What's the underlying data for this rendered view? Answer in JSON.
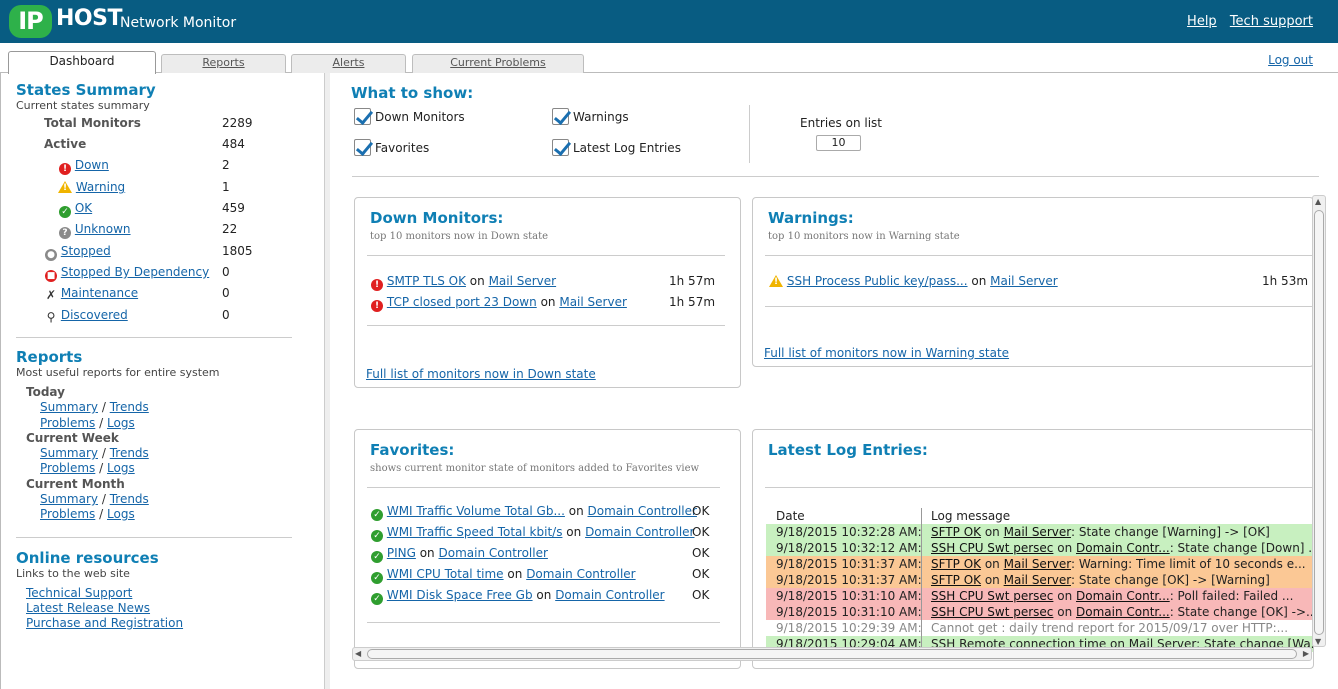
{
  "header": {
    "logo_ip": "IP",
    "logo_host": "HOST",
    "logo_subtitle": "Network Monitor",
    "links": [
      "Help",
      "Tech support"
    ],
    "colors": {
      "bar": "#085c82",
      "logo_green": "#2eb14a"
    }
  },
  "tabs": [
    "Dashboard",
    "Reports",
    "Alerts",
    "Current Problems"
  ],
  "logout": "Log out",
  "sidebar": {
    "states": {
      "title": "States Summary",
      "subtitle": "Current states summary",
      "total_label": "Total Monitors",
      "total_value": "2289",
      "active_label": "Active",
      "active_value": "484",
      "down_label": "Down",
      "down_value": "2",
      "warning_label": "Warning",
      "warning_value": "1",
      "ok_label": "OK",
      "ok_value": "459",
      "unknown_label": "Unknown",
      "unknown_value": "22",
      "stopped_label": "Stopped",
      "stopped_value": "1805",
      "stopped_dep_label": "Stopped By Dependency",
      "stopped_dep_value": "0",
      "maintenance_label": "Maintenance",
      "maintenance_value": "0",
      "discovered_label": "Discovered",
      "discovered_value": "0"
    },
    "reports": {
      "title": "Reports",
      "subtitle": "Most useful reports for entire system",
      "groups": [
        {
          "label": "Today"
        },
        {
          "label": "Current Week"
        },
        {
          "label": "Current Month"
        }
      ],
      "summary": "Summary",
      "trends": "Trends",
      "problems": "Problems",
      "logs": "Logs",
      "slash": "/"
    },
    "resources": {
      "title": "Online resources",
      "subtitle": "Links to the web site",
      "links": [
        "Technical Support",
        "Latest Release News",
        "Purchase and Registration"
      ]
    }
  },
  "show": {
    "title": "What to show:",
    "options": [
      "Down Monitors",
      "Warnings",
      "Favorites",
      "Latest Log Entries"
    ],
    "entries_label": "Entries on list",
    "entries_value": "10"
  },
  "down_panel": {
    "title": "Down Monitors:",
    "subtitle": "top 10 monitors now in Down state",
    "rows": [
      {
        "monitor": "SMTP TLS OK",
        "on": "on",
        "host": "Mail Server",
        "duration": "1h 57m"
      },
      {
        "monitor": "TCP closed port 23 Down",
        "on": "on",
        "host": "Mail Server",
        "duration": "1h 57m"
      }
    ],
    "footer": "Full list of monitors now in Down state"
  },
  "warn_panel": {
    "title": "Warnings:",
    "subtitle": "top 10 monitors now in Warning state",
    "rows": [
      {
        "monitor": "SSH Process Public key/pass...",
        "on": "on",
        "host": "Mail Server",
        "duration": "1h 53m"
      }
    ],
    "footer": "Full list of monitors now in Warning state"
  },
  "fav_panel": {
    "title": "Favorites:",
    "subtitle": "shows current monitor state of monitors added to Favorites view",
    "rows": [
      {
        "monitor": "WMI Traffic Volume Total Gb...",
        "on": "on",
        "host": "Domain Controller",
        "state": "OK"
      },
      {
        "monitor": "WMI Traffic Speed Total kbit/s",
        "on": "on",
        "host": "Domain Controller",
        "state": "OK"
      },
      {
        "monitor": "PING",
        "on": "on",
        "host": "Domain Controller",
        "state": "OK"
      },
      {
        "monitor": "WMI CPU Total time",
        "on": "on",
        "host": "Domain Controller",
        "state": "OK"
      },
      {
        "monitor": "WMI Disk Space Free Gb",
        "on": "on",
        "host": "Domain Controller",
        "state": "OK"
      }
    ]
  },
  "log_panel": {
    "title": "Latest Log Entries:",
    "col_date": "Date",
    "col_msg": "Log message",
    "rows": [
      {
        "date": "9/18/2015 10:32:28 AM:",
        "monitor": "SFTP OK",
        "on": "on",
        "host": "Mail Server",
        "text": ": State change [Warning] -> [OK]",
        "color": "#c8f0c0"
      },
      {
        "date": "9/18/2015 10:32:12 AM:",
        "monitor": "SSH CPU Swt persec",
        "on": "on",
        "host": "Domain Contr...",
        "text": ": State change [Down] ...",
        "color": "#c8f0c0"
      },
      {
        "date": "9/18/2015 10:31:37 AM:",
        "monitor": "SFTP OK",
        "on": "on",
        "host": "Mail Server",
        "text": ": Warning: Time limit of 10 seconds e...",
        "color": "#fbc895"
      },
      {
        "date": "9/18/2015 10:31:37 AM:",
        "monitor": "SFTP OK",
        "on": "on",
        "host": "Mail Server",
        "text": ": State change [OK] -> [Warning]",
        "color": "#fbc895"
      },
      {
        "date": "9/18/2015 10:31:10 AM:",
        "monitor": "SSH CPU Swt persec",
        "on": "on",
        "host": "Domain Contr...",
        "text": ": Poll failed: Failed ...",
        "color": "#f8b8b8"
      },
      {
        "date": "9/18/2015 10:31:10 AM:",
        "monitor": "SSH CPU Swt persec",
        "on": "on",
        "host": "Domain Contr...",
        "text": ": State change [OK] ->...",
        "color": "#f8b8b8"
      },
      {
        "date": "9/18/2015 10:29:39 AM:",
        "plain": "Cannot get : daily trend report for 2015/09/17 over HTTP:...",
        "color": "#ffffff"
      },
      {
        "date": "9/18/2015 10:29:04 AM:",
        "plain": "SSH Remote connection time on Mail Server: State change [Wa...",
        "color": "#c8f0c0"
      }
    ]
  }
}
